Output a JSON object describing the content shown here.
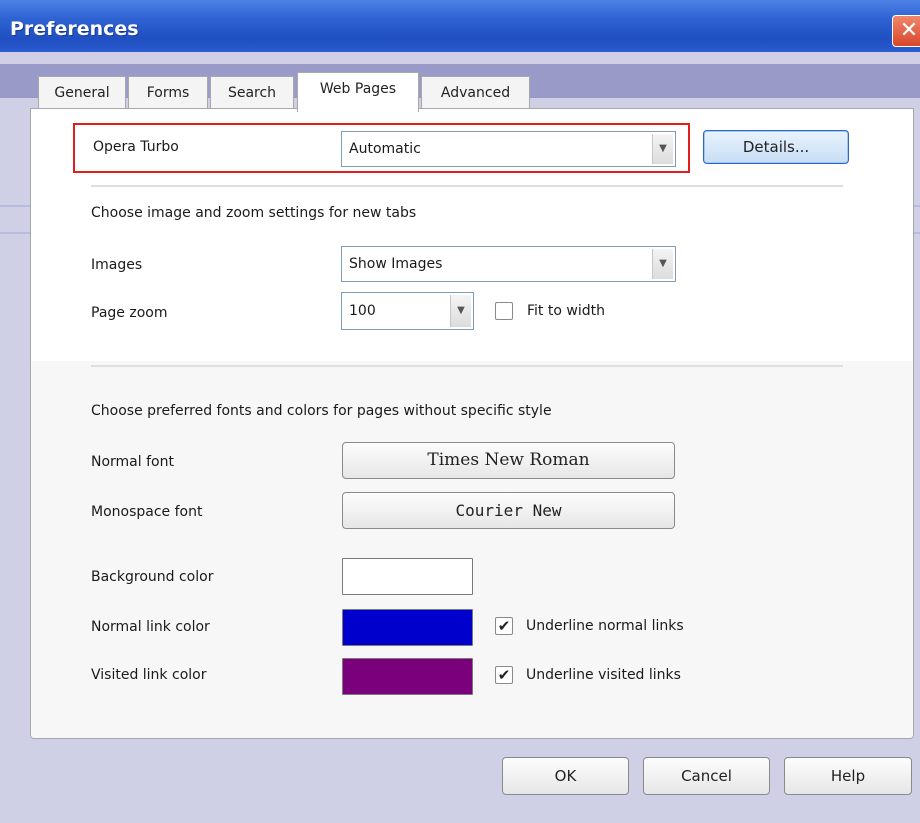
{
  "window": {
    "title": "Preferences",
    "close_glyph": "✕"
  },
  "tabs": [
    {
      "label": "General",
      "active": false
    },
    {
      "label": "Forms",
      "active": false
    },
    {
      "label": "Search",
      "active": false
    },
    {
      "label": "Web Pages",
      "active": true
    },
    {
      "label": "Advanced",
      "active": false
    }
  ],
  "opera_turbo": {
    "label": "Opera Turbo",
    "value": "Automatic",
    "details_button": "Details..."
  },
  "image_zoom": {
    "heading": "Choose image and zoom settings for new tabs",
    "images_label": "Images",
    "images_value": "Show Images",
    "zoom_label": "Page zoom",
    "zoom_value": "100",
    "fit_to_width_label": "Fit to width",
    "fit_to_width_checked": false
  },
  "fonts_colors": {
    "heading": "Choose preferred fonts and colors for pages without specific style",
    "normal_font_label": "Normal font",
    "normal_font_value": "Times New Roman",
    "mono_font_label": "Monospace font",
    "mono_font_value": "Courier New",
    "bg_color_label": "Background color",
    "bg_color": "#ffffff",
    "normal_link_label": "Normal link color",
    "normal_link_color": "#0000cc",
    "underline_normal_label": "Underline normal links",
    "underline_normal_checked": true,
    "visited_link_label": "Visited link color",
    "visited_link_color": "#7b007b",
    "underline_visited_label": "Underline visited links",
    "underline_visited_checked": true
  },
  "buttons": {
    "ok": "OK",
    "cancel": "Cancel",
    "help": "Help"
  },
  "icons": {
    "dropdown_arrow": "▼",
    "check_mark": "✔"
  },
  "colors": {
    "highlight_border": "#e01e1e",
    "titlebar": "#2f63d3"
  }
}
